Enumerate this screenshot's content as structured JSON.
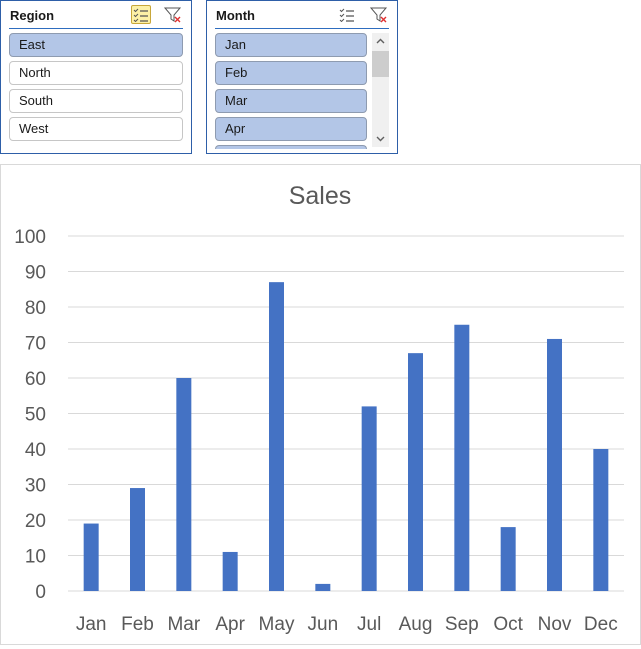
{
  "slicers": {
    "region": {
      "title": "Region",
      "multi_select_active": true,
      "items": [
        {
          "label": "East",
          "selected": true
        },
        {
          "label": "North",
          "selected": false
        },
        {
          "label": "South",
          "selected": false
        },
        {
          "label": "West",
          "selected": false
        }
      ]
    },
    "month": {
      "title": "Month",
      "multi_select_active": false,
      "items": [
        {
          "label": "Jan",
          "selected": true
        },
        {
          "label": "Feb",
          "selected": true
        },
        {
          "label": "Mar",
          "selected": true
        },
        {
          "label": "Apr",
          "selected": true
        }
      ]
    }
  },
  "colors": {
    "bar": "#4472c4",
    "gridline": "#d9d9d9",
    "axis_text": "#595959",
    "slicer_selected": "#b3c6e7",
    "slicer_border": "#2e5fa8"
  },
  "chart_data": {
    "type": "bar",
    "title": "Sales",
    "xlabel": "",
    "ylabel": "",
    "categories": [
      "Jan",
      "Feb",
      "Mar",
      "Apr",
      "May",
      "Jun",
      "Jul",
      "Aug",
      "Sep",
      "Oct",
      "Nov",
      "Dec"
    ],
    "values": [
      19,
      29,
      60,
      11,
      87,
      2,
      52,
      67,
      75,
      18,
      71,
      40
    ],
    "ylim": [
      0,
      100
    ],
    "yticks": [
      "0",
      "10",
      "20",
      "30",
      "40",
      "50",
      "60",
      "70",
      "80",
      "90",
      "100"
    ],
    "grid": true,
    "legend": "none"
  }
}
